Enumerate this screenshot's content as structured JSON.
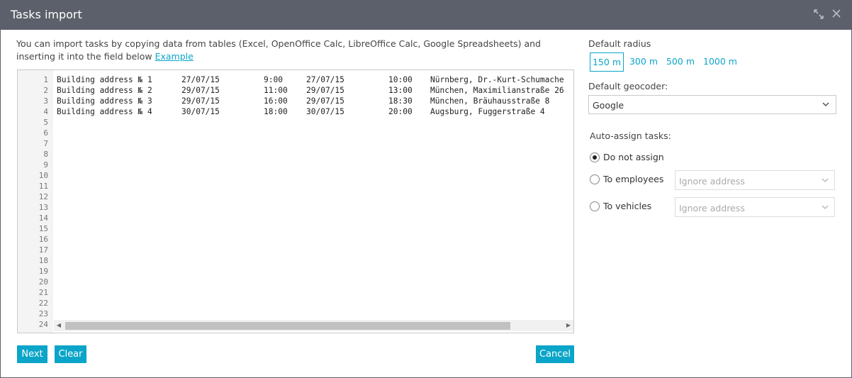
{
  "dialog": {
    "title": "Tasks import",
    "expand_icon": "expand-icon",
    "close_icon": "close-icon"
  },
  "intro": {
    "text": "You can import tasks by copying data from tables (Excel, OpenOffice Calc, LibreOffice Calc, Google Spreadsheets) and inserting it into the field below",
    "link": "Example"
  },
  "editor": {
    "line_numbers": [
      "1",
      "2",
      "3",
      "4",
      "5",
      "6",
      "7",
      "8",
      "9",
      "10",
      "11",
      "12",
      "13",
      "14",
      "15",
      "16",
      "17",
      "18",
      "19",
      "20",
      "21",
      "22",
      "23",
      "24"
    ],
    "rows": [
      [
        "Building address № 1",
        "27/07/15",
        "9:00",
        "27/07/15",
        "10:00",
        "Nürnberg, Dr.-Kurt-Schumache"
      ],
      [
        "Building address № 2",
        "29/07/15",
        "11:00",
        "29/07/15",
        "13:00",
        "München, Maximilianstraße 26"
      ],
      [
        "Building address № 3",
        "29/07/15",
        "16:00",
        "29/07/15",
        "18:30",
        "München, Bräuhausstraße 8"
      ],
      [
        "Building address № 4",
        "30/07/15",
        "18:00",
        "30/07/15",
        "20:00",
        "Augsburg, Fuggerstraße 4"
      ]
    ]
  },
  "buttons": {
    "next": "Next",
    "clear": "Clear",
    "cancel": "Cancel"
  },
  "radius": {
    "label": "Default radius",
    "options": [
      "150 m",
      "300 m",
      "500 m",
      "1000 m"
    ],
    "selected": "150 m"
  },
  "geocoder": {
    "label": "Default geocoder:",
    "value": "Google"
  },
  "auto_assign": {
    "label": "Auto-assign tasks:",
    "options": [
      {
        "label": "Do not assign",
        "checked": true
      },
      {
        "label": "To employees",
        "checked": false,
        "select_value": "Ignore address"
      },
      {
        "label": "To vehicles",
        "checked": false,
        "select_value": "Ignore address"
      }
    ]
  },
  "colors": {
    "titlebar": "#5c606b",
    "accent": "#0aa5c8"
  }
}
